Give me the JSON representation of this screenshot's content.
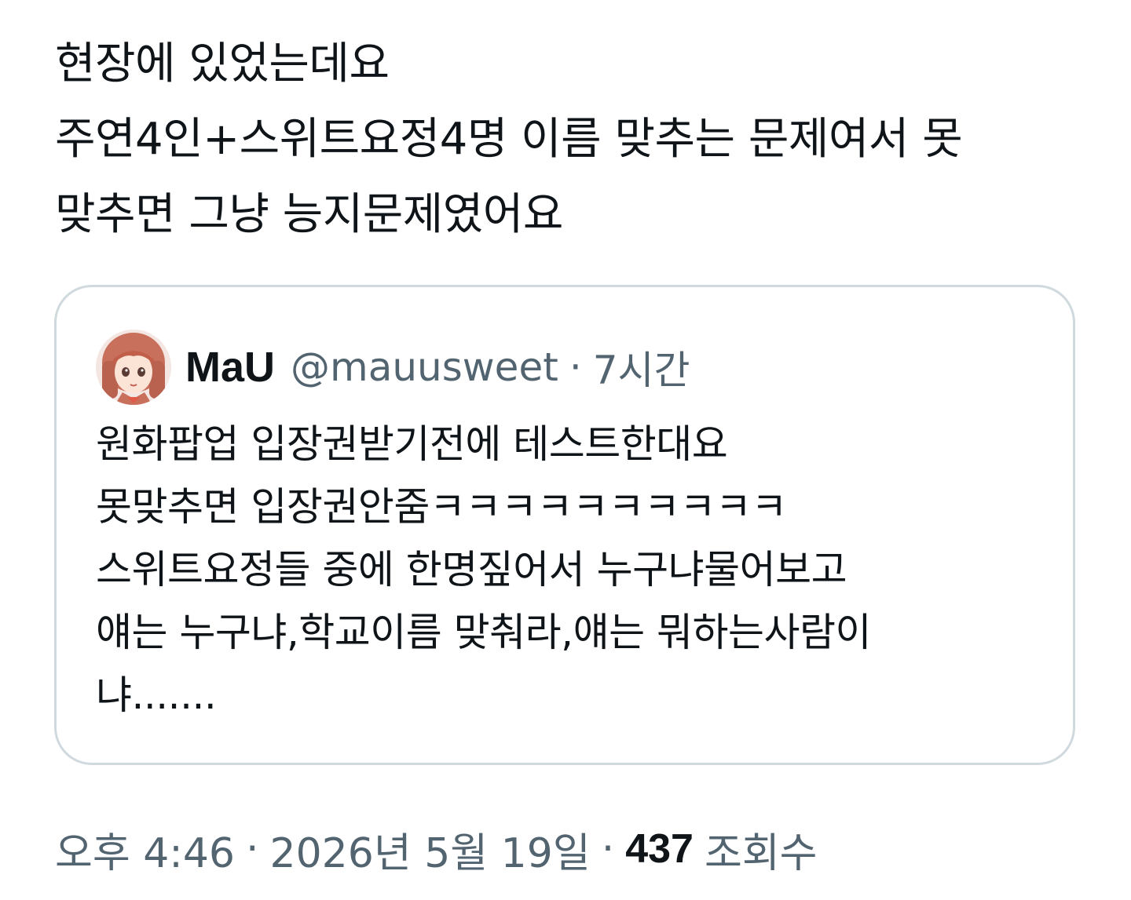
{
  "tweet": {
    "text_lines": [
      "현장에 있었는데요",
      "주연4인+스위트요정4명 이름 맞추는 문제여서 못",
      "맞추면 그냥 능지문제였어요"
    ],
    "time": "오후 4:46",
    "date": "2026년 5월 19일",
    "views_count": "437",
    "views_label": "조회수",
    "separator": "·"
  },
  "quoted_tweet": {
    "avatar_icon": "anime-girl-avatar-icon",
    "author_name": "MaU",
    "author_handle": "@mauusweet",
    "separator": "·",
    "time_ago": "7시간",
    "text_lines": [
      "원화팝업 입장권받기전에 테스트한대요",
      "못맞추면 입장권안줌ㅋㅋㅋㅋㅋㅋㅋㅋㅋㅋ",
      "스위트요정들 중에 한명짚어서 누구냐물어보고",
      "얘는 누구냐,학교이름 맞춰라,얘는 뭐하는사람이",
      "냐......."
    ]
  },
  "colors": {
    "text_primary": "#0f1419",
    "text_secondary": "#536471",
    "card_border": "#cfd9de"
  }
}
